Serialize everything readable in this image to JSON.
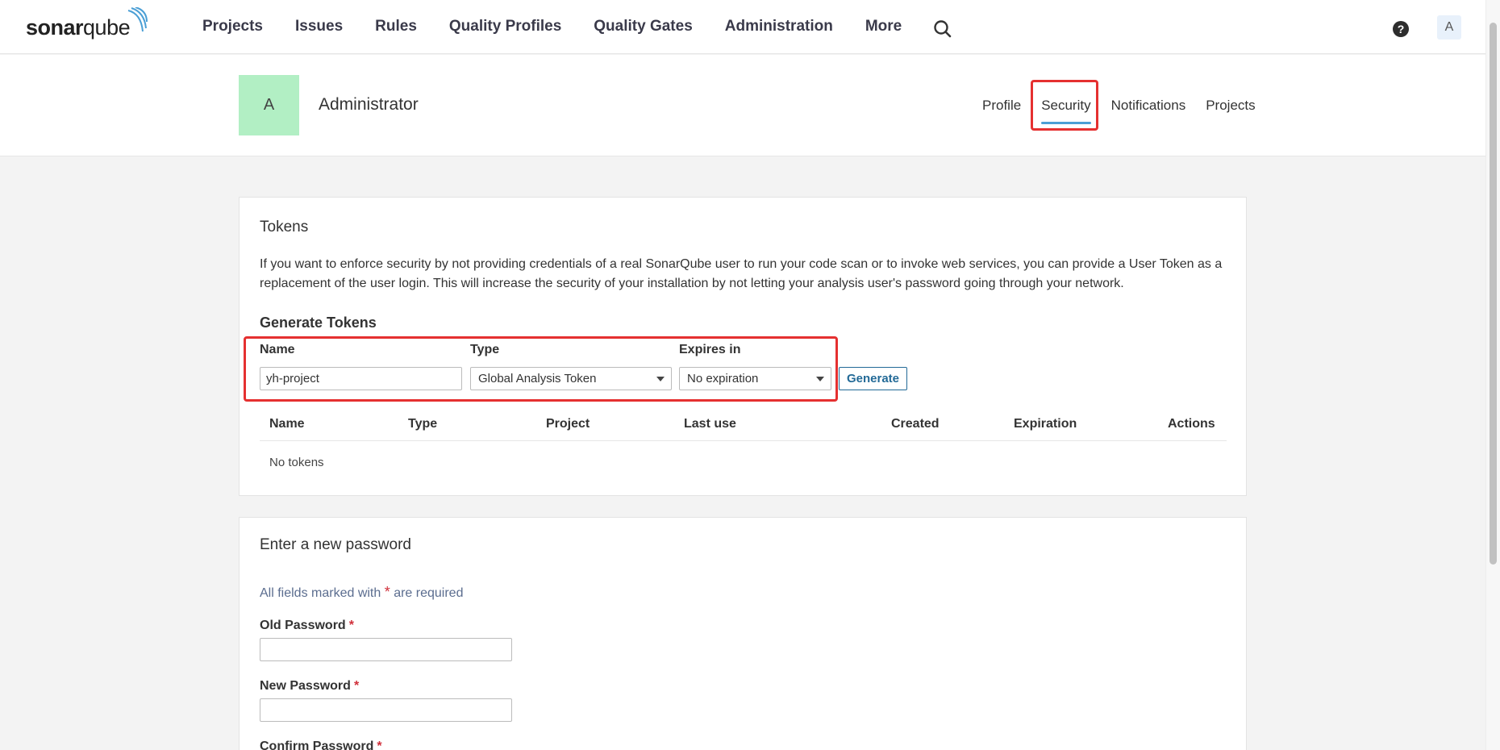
{
  "navbar": {
    "logo": {
      "bold": "sonar",
      "regular": "qube"
    },
    "items": [
      "Projects",
      "Issues",
      "Rules",
      "Quality Profiles",
      "Quality Gates",
      "Administration",
      "More"
    ],
    "avatar_letter": "A"
  },
  "account": {
    "avatar_letter": "A",
    "name": "Administrator",
    "tabs": [
      "Profile",
      "Security",
      "Notifications",
      "Projects"
    ],
    "active_tab": "Security"
  },
  "tokens": {
    "title": "Tokens",
    "description": "If you want to enforce security by not providing credentials of a real SonarQube user to run your code scan or to invoke web services, you can provide a User Token as a replacement of the user login. This will increase the security of your installation by not letting your analysis user's password going through your network.",
    "generate_title": "Generate Tokens",
    "form": {
      "name_label": "Name",
      "name_value": "yh-project",
      "type_label": "Type",
      "type_value": "Global Analysis Token",
      "expires_label": "Expires in",
      "expires_value": "No expiration",
      "generate_button": "Generate"
    },
    "table": {
      "columns": [
        "Name",
        "Type",
        "Project",
        "Last use",
        "Created",
        "Expiration",
        "Actions"
      ],
      "empty_text": "No tokens"
    }
  },
  "password": {
    "title": "Enter a new password",
    "required_note_prefix": "All fields marked with",
    "required_star": "*",
    "required_note_suffix": "are required",
    "fields": [
      "Old Password",
      "New Password",
      "Confirm Password"
    ]
  },
  "colors": {
    "highlight": "#e53030",
    "accent": "#4b9fd5",
    "avatar_bg": "#b2efc4",
    "button": "#236a97"
  }
}
